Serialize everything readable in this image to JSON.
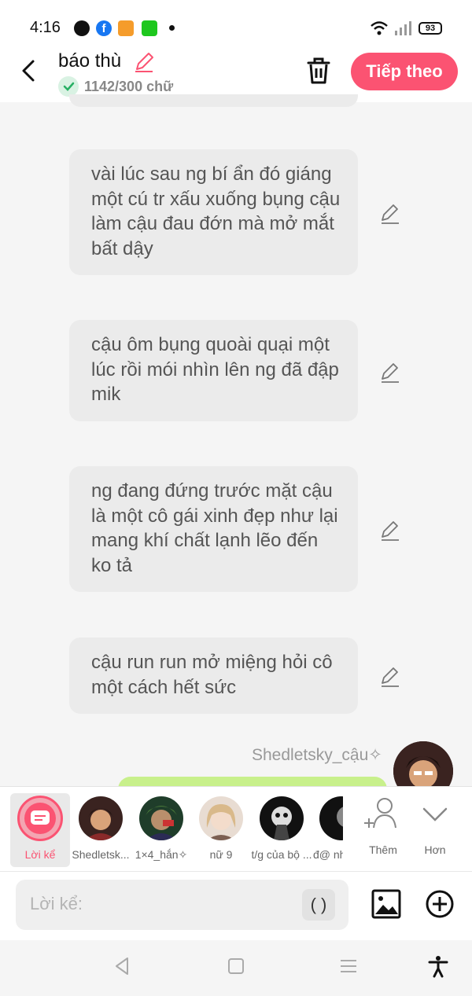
{
  "status_bar": {
    "time": "4:16",
    "battery": "93",
    "icons": [
      "messenger-icon",
      "facebook-icon",
      "game-icon",
      "sheet-icon",
      "notification-dot",
      "wifi-icon",
      "signal-icon",
      "battery-icon"
    ]
  },
  "header": {
    "title": "báo thù",
    "word_count": "1142/300 chữ",
    "next_label": "Tiếp theo"
  },
  "messages": [
    {
      "text": "vài lúc sau ng bí ẩn đó giáng một cú tr xấu xuống bụng cậu làm cậu đau đớn mà mở mắt bất dậy"
    },
    {
      "text": "cậu ôm bụng quoài quại một lúc rồi mói nhìn lên ng đã đập mik"
    },
    {
      "text": "ng đang đứng trước mặt cậu là một cô gái xinh đẹp như lại mang khí chất lạnh lẽo đến ko tả"
    },
    {
      "text": "cậu run run mở miệng hỏi cô một cách hết sức"
    }
  ],
  "speaker": {
    "name": "Shedletsky_cậu✧"
  },
  "characters": [
    {
      "label": "Lời kể",
      "selected": true
    },
    {
      "label": "Shedletsk..."
    },
    {
      "label": "1×4_hắn✧"
    },
    {
      "label": "nữ 9"
    },
    {
      "label": "t/g của bộ ..."
    },
    {
      "label": "đ@ nh"
    }
  ],
  "more_actions": {
    "add_label": "Thêm",
    "more_label": "Hơn"
  },
  "input": {
    "placeholder": "Lời kể:",
    "paren_label": "( )"
  },
  "colors": {
    "accent": "#fb5372",
    "bubble": "#ebebeb",
    "speaker_bubble": "#c8f08b"
  }
}
